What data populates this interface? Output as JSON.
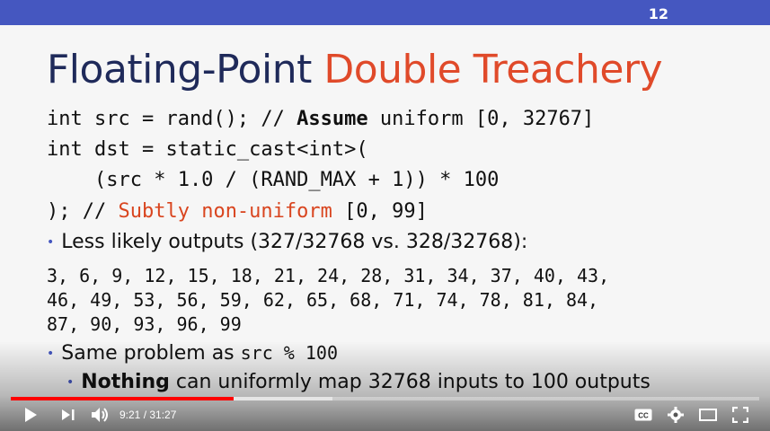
{
  "slide": {
    "number": "12",
    "title_part1": "Floating-Point ",
    "title_part2": "Double Treachery",
    "code_line1_a": "int src = rand(); // ",
    "code_line1_b": "Assume",
    "code_line1_c": " uniform [0, 32767]",
    "code_line2": "int dst = static_cast<int>(",
    "code_line3": "    (src * 1.0 / (RAND_MAX + 1)) * 100",
    "code_line4_a": "); // ",
    "code_line4_b": "Subtly non-uniform",
    "code_line4_c": " [0, 99]",
    "bullet1": "Less likely outputs (327/32768 vs. 328/32768):",
    "numbers_line1": "3, 6, 9, 12, 15, 18, 21, 24, 28, 31, 34, 37, 40, 43,",
    "numbers_line2": "46, 49, 53, 56, 59, 62, 65, 68, 71, 74, 78, 81, 84,",
    "numbers_line3": "87, 90, 93, 96, 99",
    "bullet2_a": "Same problem as ",
    "bullet2_code": "src % 100",
    "sub_bullet_bold": "Nothing",
    "sub_bullet_rest": " can uniformly map 32768 inputs to 100 outputs"
  },
  "player": {
    "time": "9:21 / 31:27",
    "progress_fraction": 0.298,
    "buffer_fraction": 0.43,
    "icons": [
      "play-icon",
      "next-icon",
      "volume-icon",
      "captions-icon",
      "settings-icon",
      "theater-icon",
      "fullscreen-icon"
    ]
  },
  "colors": {
    "topbar": "#4557c0",
    "title": "#1f2a5a",
    "accent": "#e04a2a",
    "progress": "#ff0000"
  }
}
